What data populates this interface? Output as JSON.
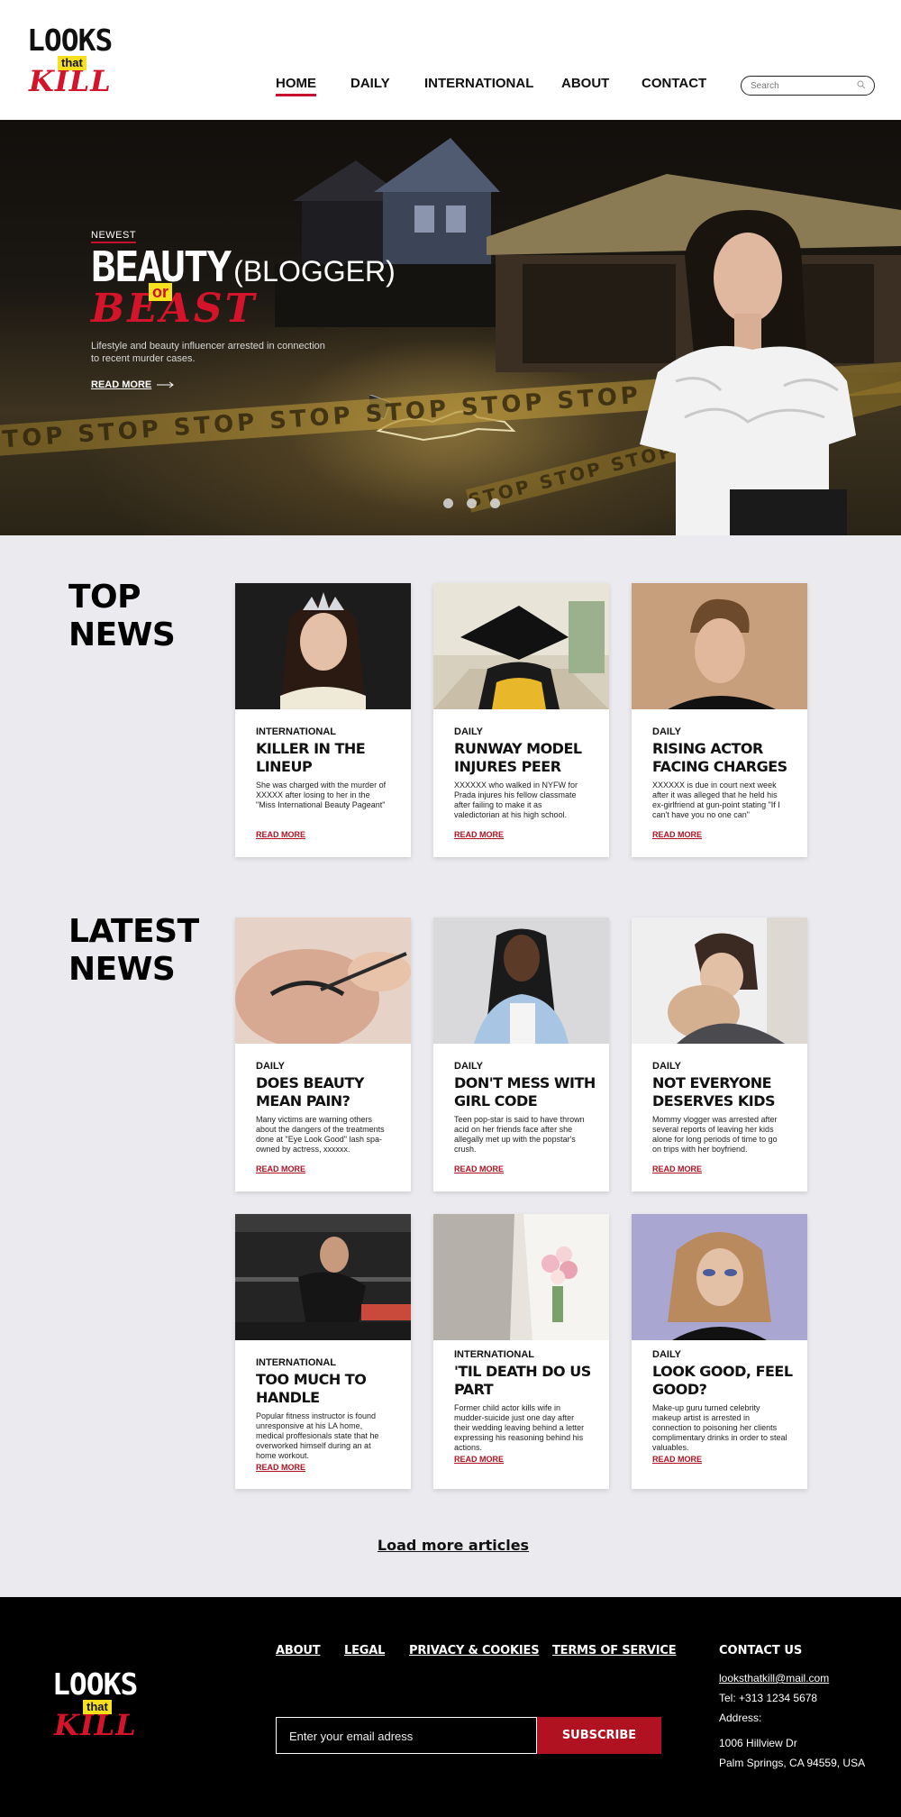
{
  "brand": {
    "word1": "LOOKS",
    "word2": "that",
    "word3": "KILL",
    "yellow": "#f7e01c",
    "red": "#d4142a"
  },
  "header": {
    "nav": [
      {
        "label": "HOME",
        "active": true
      },
      {
        "label": "DAILY",
        "active": false
      },
      {
        "label": "INTERNATIONAL",
        "active": false
      },
      {
        "label": "ABOUT",
        "active": false
      },
      {
        "label": "CONTACT",
        "active": false
      }
    ],
    "search_placeholder": "Search"
  },
  "hero": {
    "kicker": "NEWEST",
    "title_main": "BEAUTY",
    "title_paren": "(BLOGGER)",
    "title_or": "or",
    "title_beast": "BEAST",
    "subtitle": "Lifestyle and beauty influencer arrested in connection to recent murder cases.",
    "read_more": "READ MORE",
    "tape_text": "STOP  STOP  STOP  STOP  STOP  STOP  STOP  STOP",
    "tape2_text": "STOP  STOP  STOP  STOP",
    "slides": 3,
    "active_slide": 1
  },
  "top_news": {
    "title_line1": "TOP",
    "title_line2": "NEWS",
    "cards": [
      {
        "category": "INTERNATIONAL",
        "title": "KILLER IN THE LINEUP",
        "description": "She was charged with the murder of XXXXX after losing to her in the \"Miss International Beauty Pageant\"",
        "read_more": "READ MORE",
        "image": "pageant-crown"
      },
      {
        "category": "DAILY",
        "title": "RUNWAY MODEL INJURES PEER",
        "description": "XXXXXX who walked in NYFW for Prada injures his fellow classmate after failing to make it as valedictorian at his high school.",
        "read_more": "READ MORE",
        "image": "graduation-cap"
      },
      {
        "category": "DAILY",
        "title": "RISING ACTOR FACING CHARGES",
        "description": "XXXXXX is due in court next week after it was alleged that he held his ex-girlfriend at gun-point stating \"If I can't have you no one can\"",
        "read_more": "READ MORE",
        "image": "young-man-portrait"
      }
    ]
  },
  "latest_news": {
    "title_line1": "LATEST",
    "title_line2": "NEWS",
    "cards": [
      {
        "category": "DAILY",
        "title": "DOES BEAUTY MEAN PAIN?",
        "description": "Many victims are warning others about the dangers of the treatments done at \"Eye Look Good\" lash spa- owned by actress, xxxxxx.",
        "read_more": "READ MORE",
        "image": "lash-treatment"
      },
      {
        "category": "DAILY",
        "title": "DON'T MESS WITH GIRL CODE",
        "description": "Teen pop-star is said to have thrown acid on her friends face after she allegally met up with the popstar's crush.",
        "read_more": "READ MORE",
        "image": "woman-braids"
      },
      {
        "category": "DAILY",
        "title": "NOT EVERYONE DESERVES KIDS",
        "description": "Mommy vlogger was arrested after several reports of leaving her kids alone for long periods of time to go on trips with her boyfriend.",
        "read_more": "READ MORE",
        "image": "mother-child"
      },
      {
        "category": "INTERNATIONAL",
        "title": "TOO MUCH TO HANDLE",
        "description": "Popular fitness instructor is found unresponsive at his LA home, medical proffesionals state that he overworked himself during an at home workout.",
        "read_more": "READ MORE",
        "image": "gym-man"
      },
      {
        "category": "INTERNATIONAL",
        "title": "'TIL DEATH DO US PART",
        "description": "Former child actor kills wife in mudder-suicide just one day after their wedding leaving behind a letter expressing his reasoning behind his actions.",
        "read_more": "READ MORE",
        "image": "wedding-bouquet"
      },
      {
        "category": "DAILY",
        "title": "LOOK GOOD, FEEL GOOD?",
        "description": "Make-up guru turned celebrity makeup artist is arrested in connection to poisoning her clients complimentary drinks in order to steal valuables.",
        "read_more": "READ MORE",
        "image": "makeup-woman"
      }
    ]
  },
  "load_more": "Load more articles",
  "footer": {
    "links": [
      "ABOUT",
      "LEGAL",
      "PRIVACY & COOKIES",
      "TERMS OF SERVICE"
    ],
    "email_placeholder": "Enter your email adress",
    "subscribe": "SUBSCRIBE",
    "contact_title": "CONTACT US",
    "contact_email": "looksthatkill@mail.com",
    "contact_tel": "Tel: +313 1234 5678",
    "address_label": "Address:",
    "address_line1": "1006 Hillview Dr",
    "address_line2": "Palm Springs, CA 94559, USA"
  }
}
